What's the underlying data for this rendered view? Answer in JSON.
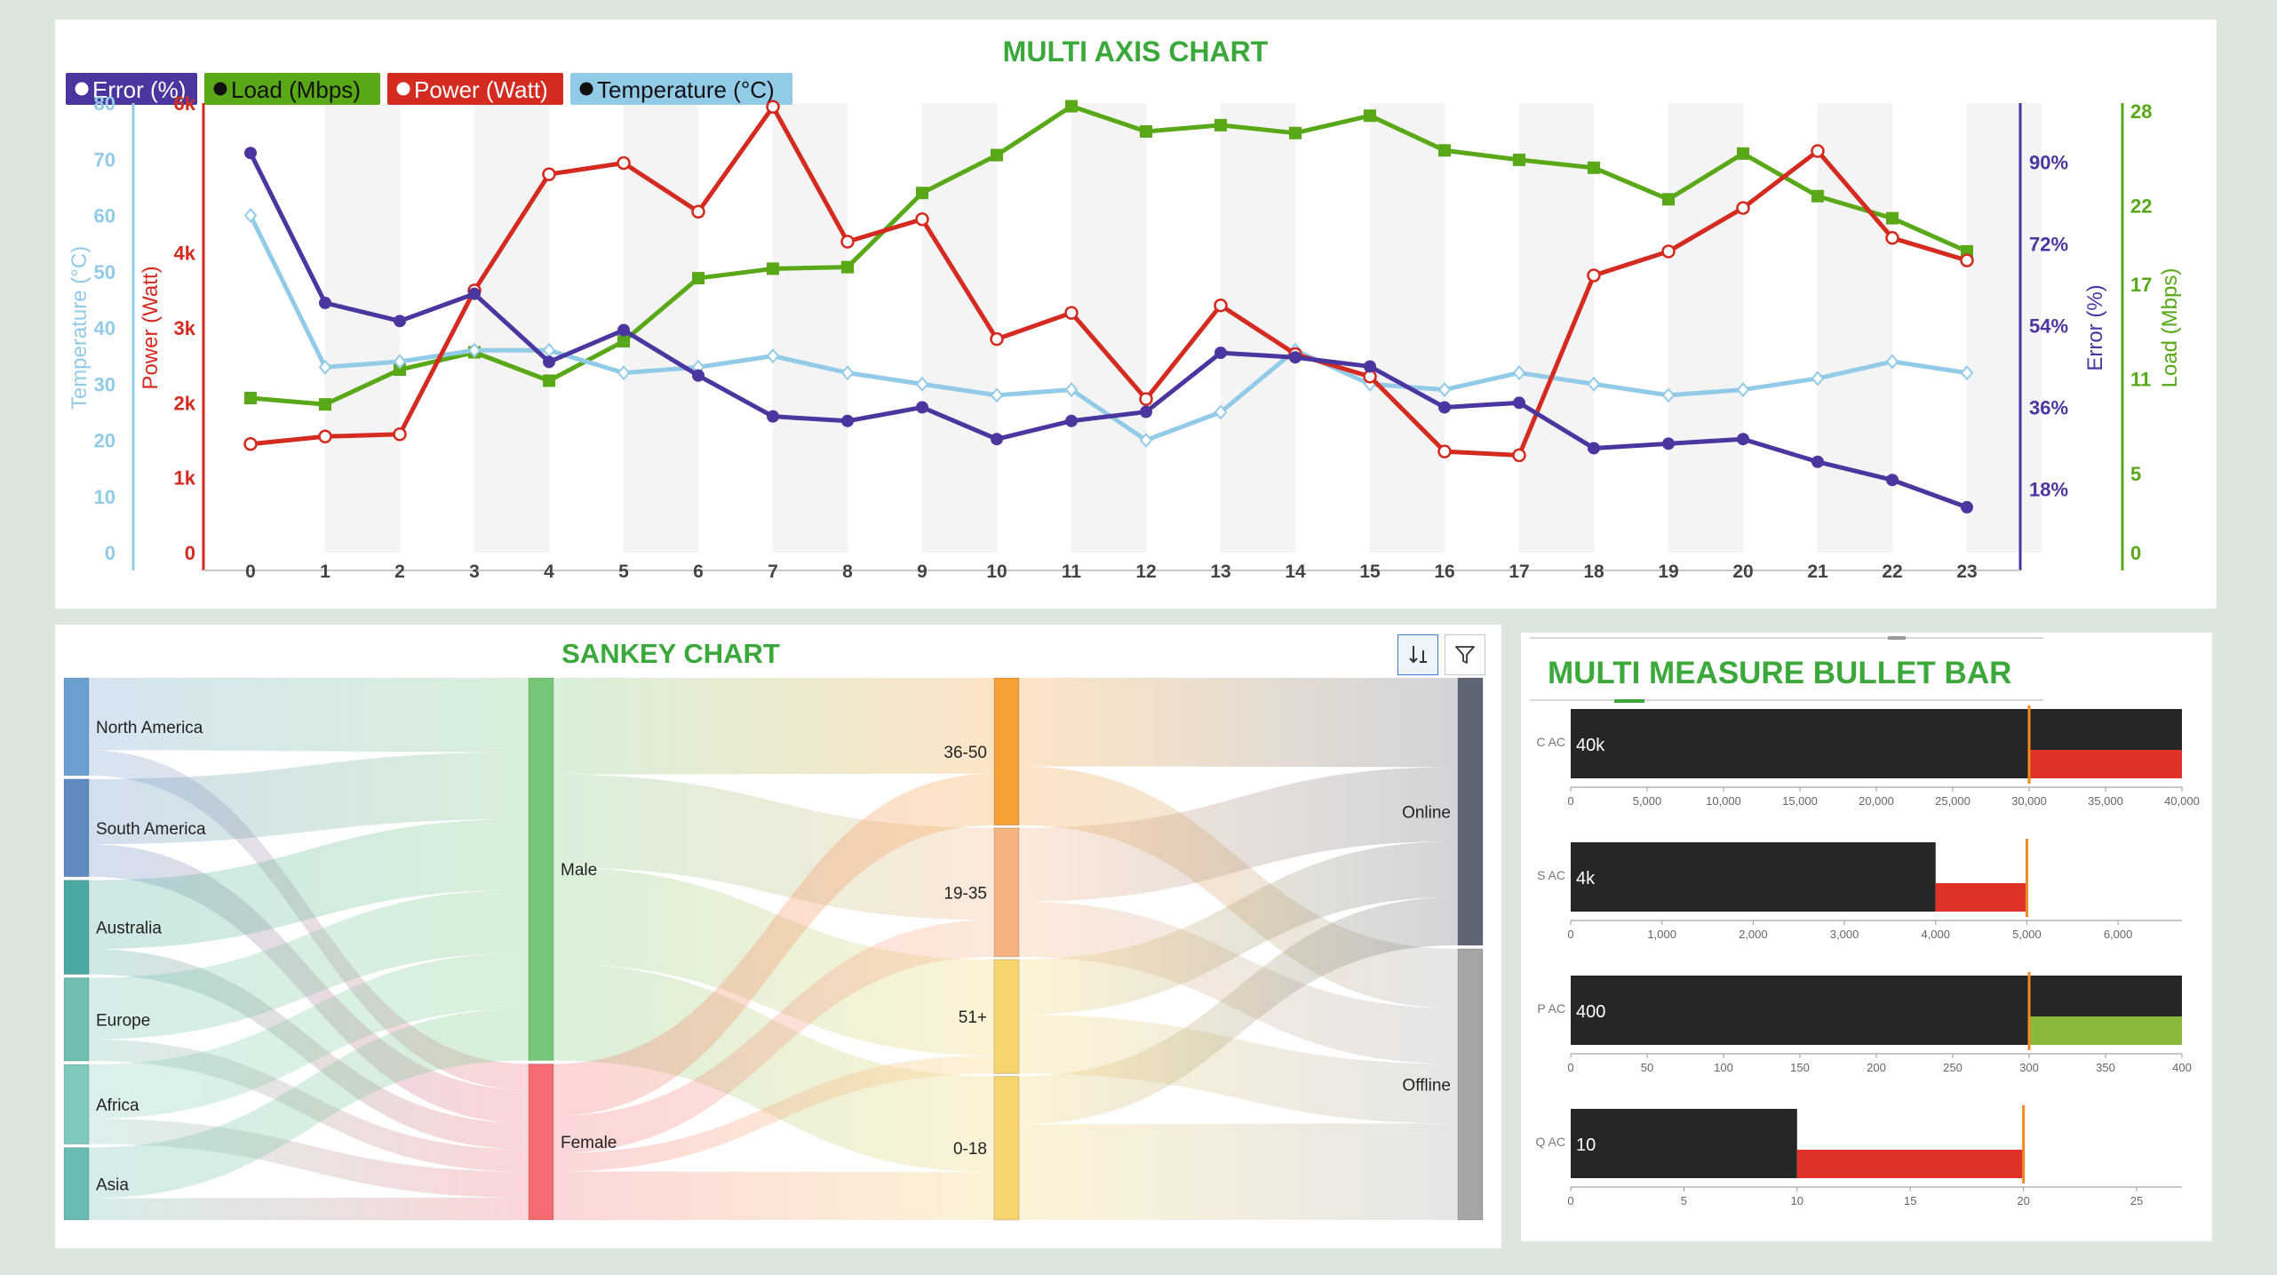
{
  "multi_axis": {
    "title": "MULTI AXIS CHART",
    "legend": [
      "Error (%)",
      "Load (Mbps)",
      "Power (Watt)",
      "Temperature (°C)"
    ]
  },
  "sankey": {
    "title": "SANKEY CHART",
    "toolbar": {
      "sort_icon": "sort-down-icon",
      "filter_icon": "filter-icon"
    }
  },
  "bullet": {
    "title": "MULTI MEASURE BULLET BAR"
  },
  "colors": {
    "error": "#4b36a0",
    "load": "#58a818",
    "power": "#d42a20",
    "temperature": "#92cbe8",
    "title_green": "#3aa83a",
    "bullet_bar": "#262626",
    "bullet_red": "#e0302a",
    "bullet_green": "#8ab83a",
    "target": "#f08a24"
  },
  "chart_data": [
    {
      "type": "line",
      "title": "MULTI AXIS CHART",
      "categories": [
        "0",
        "1",
        "2",
        "3",
        "4",
        "5",
        "6",
        "7",
        "8",
        "9",
        "10",
        "11",
        "12",
        "13",
        "14",
        "15",
        "16",
        "17",
        "18",
        "19",
        "20",
        "21",
        "22",
        "23"
      ],
      "x": [
        0,
        1,
        2,
        3,
        4,
        5,
        6,
        7,
        8,
        9,
        10,
        11,
        12,
        13,
        14,
        15,
        16,
        17,
        18,
        19,
        20,
        21,
        22,
        23
      ],
      "grid": "alternating vertical bands",
      "legend_position": "top-left",
      "series": [
        {
          "name": "Error (%)",
          "axis": "right-1",
          "ylabel": "Error (%)",
          "ylim": [
            4,
            103
          ],
          "ticks": [
            18,
            36,
            54,
            72,
            90
          ],
          "tick_labels": [
            "18%",
            "36%",
            "54%",
            "72%",
            "90%"
          ],
          "values": [
            92,
            59,
            55,
            61,
            46,
            53,
            43,
            34,
            33,
            36,
            29,
            33,
            35,
            48,
            47,
            45,
            36,
            37,
            27,
            28,
            29,
            24,
            20,
            14
          ],
          "marker": "circle-filled",
          "color": "#4b36a0"
        },
        {
          "name": "Load (Mbps)",
          "axis": "right-2",
          "ylabel": "Load (Mbps)",
          "ylim": [
            0,
            28.5
          ],
          "ticks": [
            0,
            5,
            11,
            17,
            22,
            28
          ],
          "tick_labels": [
            "0",
            "5",
            "11",
            "17",
            "22",
            "28"
          ],
          "values": [
            9.8,
            9.4,
            11.6,
            12.7,
            10.9,
            13.4,
            17.4,
            18.0,
            18.1,
            22.8,
            25.2,
            28.3,
            26.7,
            27.1,
            26.6,
            27.7,
            25.5,
            24.9,
            24.4,
            22.4,
            25.3,
            22.6,
            21.2,
            19.1
          ],
          "marker": "square",
          "color": "#58a818"
        },
        {
          "name": "Power (Watt)",
          "axis": "left-2",
          "ylabel": "Power (Watt)",
          "ylim": [
            0,
            6000
          ],
          "ticks": [
            0,
            1000,
            2000,
            3000,
            4000,
            6000
          ],
          "tick_labels": [
            "0",
            "1k",
            "2k",
            "3k",
            "4k",
            "6k"
          ],
          "values": [
            1450,
            1550,
            1580,
            3500,
            5050,
            5200,
            4550,
            5950,
            4150,
            4450,
            2850,
            3200,
            2050,
            3300,
            2650,
            2350,
            1350,
            1300,
            3700,
            4020,
            4600,
            5360,
            4200,
            3900
          ],
          "marker": "circle-open",
          "color": "#d42a20"
        },
        {
          "name": "Temperature (°C)",
          "axis": "left-1",
          "ylabel": "Temperature (°C)",
          "ylim": [
            0,
            80
          ],
          "ticks": [
            0,
            10,
            20,
            30,
            40,
            50,
            60,
            70,
            80
          ],
          "tick_labels": [
            "0",
            "10",
            "20",
            "30",
            "40",
            "50",
            "60",
            "70",
            "80"
          ],
          "values": [
            60,
            33,
            34,
            36,
            36,
            32,
            33,
            35,
            32,
            30,
            28,
            29,
            20,
            25,
            36,
            30,
            29,
            32,
            30,
            28,
            29,
            31,
            34,
            32
          ],
          "marker": "diamond-open",
          "color": "#92cbe8"
        }
      ]
    },
    {
      "type": "sankey",
      "title": "SANKEY CHART",
      "columns": [
        [
          "North America",
          "South America",
          "Australia",
          "Europe",
          "Africa",
          "Asia"
        ],
        [
          "Male",
          "Female"
        ],
        [
          "36-50",
          "19-35",
          "51+",
          "0-18"
        ],
        [
          "Online",
          "Offline"
        ]
      ],
      "node_colors": {
        "North America": "#6b9fd0",
        "South America": "#5f8bc2",
        "Australia": "#4aa8a0",
        "Europe": "#6fbfb3",
        "Africa": "#7fc8bc",
        "Asia": "#6abcb2",
        "Male": "#76c878",
        "Female": "#f46b72",
        "36-50": "#f7a035",
        "19-35": "#f5b27e",
        "51+": "#f8d46e",
        "0-18": "#f6d46e",
        "Online": "#5e6675",
        "Offline": "#a5a5a5"
      },
      "links": [
        {
          "source": "North America",
          "target": "Male",
          "value": 20
        },
        {
          "source": "North America",
          "target": "Female",
          "value": 7
        },
        {
          "source": "South America",
          "target": "Male",
          "value": 18
        },
        {
          "source": "South America",
          "target": "Female",
          "value": 9
        },
        {
          "source": "Australia",
          "target": "Male",
          "value": 19
        },
        {
          "source": "Australia",
          "target": "Female",
          "value": 7
        },
        {
          "source": "Europe",
          "target": "Male",
          "value": 17
        },
        {
          "source": "Europe",
          "target": "Female",
          "value": 6
        },
        {
          "source": "Africa",
          "target": "Male",
          "value": 15
        },
        {
          "source": "Africa",
          "target": "Female",
          "value": 7
        },
        {
          "source": "Asia",
          "target": "Male",
          "value": 14
        },
        {
          "source": "Asia",
          "target": "Female",
          "value": 6
        },
        {
          "source": "Male",
          "target": "36-50",
          "value": 26
        },
        {
          "source": "Male",
          "target": "19-35",
          "value": 25
        },
        {
          "source": "Male",
          "target": "51+",
          "value": 26
        },
        {
          "source": "Male",
          "target": "0-18",
          "value": 26
        },
        {
          "source": "Female",
          "target": "36-50",
          "value": 14
        },
        {
          "source": "Female",
          "target": "19-35",
          "value": 10
        },
        {
          "source": "Female",
          "target": "51+",
          "value": 5
        },
        {
          "source": "Female",
          "target": "0-18",
          "value": 13
        },
        {
          "source": "36-50",
          "target": "Online",
          "value": 24
        },
        {
          "source": "36-50",
          "target": "Offline",
          "value": 16
        },
        {
          "source": "19-35",
          "target": "Online",
          "value": 20
        },
        {
          "source": "19-35",
          "target": "Offline",
          "value": 15
        },
        {
          "source": "51+",
          "target": "Online",
          "value": 15
        },
        {
          "source": "51+",
          "target": "Offline",
          "value": 16
        },
        {
          "source": "0-18",
          "target": "Online",
          "value": 13
        },
        {
          "source": "0-18",
          "target": "Offline",
          "value": 26
        }
      ]
    },
    {
      "type": "bar",
      "subtype": "bullet",
      "title": "MULTI MEASURE BULLET BAR",
      "rows": [
        {
          "label": "C AC",
          "value": 30000,
          "value_label": "40k",
          "target": 30000,
          "excess": 40000,
          "excess_color": "red",
          "xlim": [
            0,
            40000
          ],
          "ticks": [
            0,
            5000,
            10000,
            15000,
            20000,
            25000,
            30000,
            35000,
            40000
          ],
          "tick_labels": [
            "0",
            "5,000",
            "10,000",
            "15,000",
            "20,000",
            "25,000",
            "30,000",
            "35,000",
            "40,000"
          ]
        },
        {
          "label": "S AC",
          "value": 4000,
          "value_label": "4k",
          "target": 5000,
          "excess": 5000,
          "excess_color": "red",
          "xlim": [
            0,
            6700
          ],
          "ticks": [
            0,
            1000,
            2000,
            3000,
            4000,
            5000,
            6000
          ],
          "tick_labels": [
            "0",
            "1,000",
            "2,000",
            "3,000",
            "4,000",
            "5,000",
            "6,000"
          ]
        },
        {
          "label": "P AC",
          "value": 300,
          "value_label": "400",
          "target": 300,
          "excess": 400,
          "excess_color": "green",
          "xlim": [
            0,
            400
          ],
          "ticks": [
            0,
            50,
            100,
            150,
            200,
            250,
            300,
            350,
            400
          ],
          "tick_labels": [
            "0",
            "50",
            "100",
            "150",
            "200",
            "250",
            "300",
            "350",
            "400"
          ]
        },
        {
          "label": "Q AC",
          "value": 10,
          "value_label": "10",
          "target": 20,
          "excess": 20,
          "excess_color": "red",
          "xlim": [
            0,
            27
          ],
          "ticks": [
            0,
            5,
            10,
            15,
            20,
            25
          ],
          "tick_labels": [
            "0",
            "5",
            "10",
            "15",
            "20",
            "25"
          ]
        }
      ]
    }
  ]
}
